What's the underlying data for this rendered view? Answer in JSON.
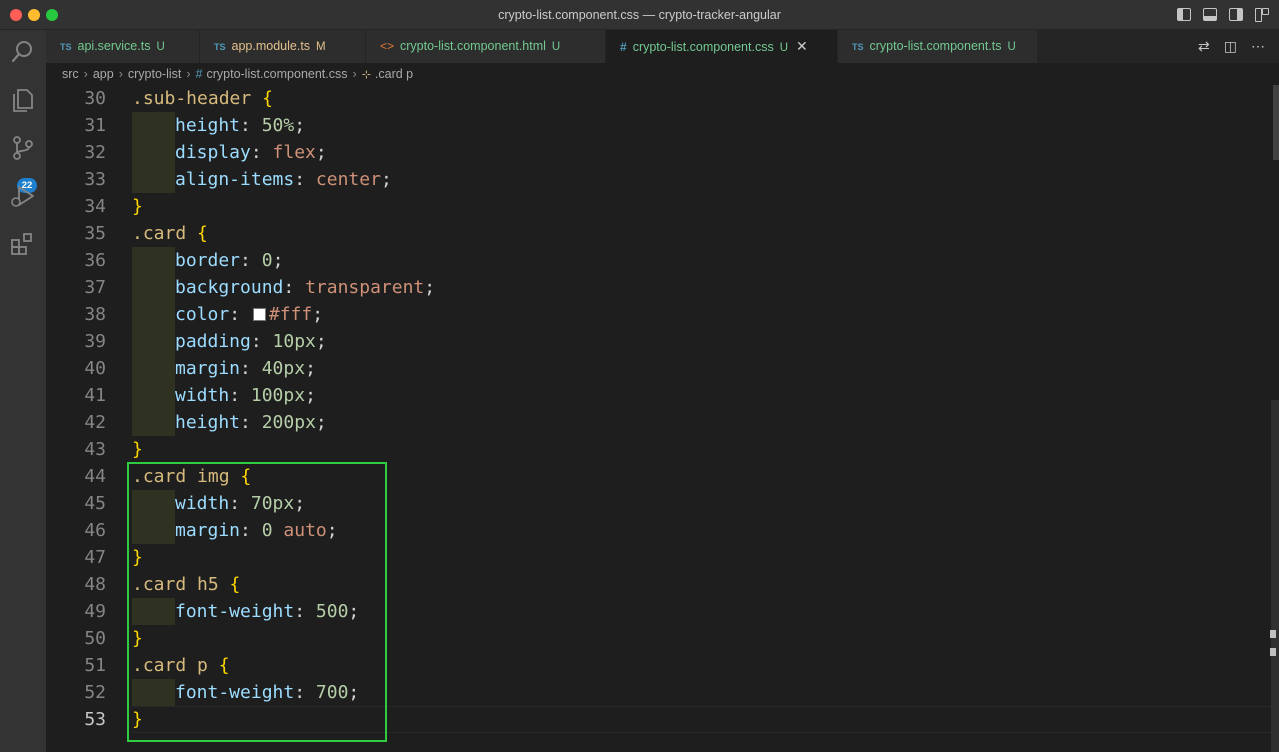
{
  "window": {
    "title": "crypto-list.component.css — crypto-tracker-angular"
  },
  "activity": {
    "scm_badge": "22"
  },
  "tabs": [
    {
      "icon": "TS",
      "label": "api.service.ts",
      "status": "U",
      "kind": "u"
    },
    {
      "icon": "TS",
      "label": "app.module.ts",
      "status": "M",
      "kind": "m"
    },
    {
      "icon": "<>",
      "label": "crypto-list.component.html",
      "status": "U",
      "kind": "u"
    },
    {
      "icon": "#",
      "label": "crypto-list.component.css",
      "status": "U",
      "kind": "u",
      "active": true
    },
    {
      "icon": "TS",
      "label": "crypto-list.component.ts",
      "status": "U",
      "kind": "u"
    }
  ],
  "breadcrumb": [
    "src",
    "app",
    "crypto-list",
    "crypto-list.component.css",
    ".card p"
  ],
  "lines": [
    {
      "n": "30",
      "sel": ".sub-header"
    },
    {
      "n": "31",
      "prop": "height",
      "num": "50%"
    },
    {
      "n": "32",
      "prop": "display",
      "val": "flex"
    },
    {
      "n": "33",
      "prop": "align-items",
      "val": "center"
    },
    {
      "n": "34",
      "close": true
    },
    {
      "n": "35",
      "sel": ".card"
    },
    {
      "n": "36",
      "prop": "border",
      "num": "0"
    },
    {
      "n": "37",
      "prop": "background",
      "val": "transparent"
    },
    {
      "n": "38",
      "prop": "color",
      "val": "#fff",
      "swatch": "#ffffff"
    },
    {
      "n": "39",
      "prop": "padding",
      "num": "10px"
    },
    {
      "n": "40",
      "prop": "margin",
      "num": "40px"
    },
    {
      "n": "41",
      "prop": "width",
      "num": "100px"
    },
    {
      "n": "42",
      "prop": "height",
      "num": "200px"
    },
    {
      "n": "43",
      "close": true
    },
    {
      "n": "44",
      "sel": ".card img"
    },
    {
      "n": "45",
      "prop": "width",
      "num": "70px"
    },
    {
      "n": "46",
      "prop": "margin",
      "num": "0",
      "val": "auto"
    },
    {
      "n": "47",
      "close": true
    },
    {
      "n": "48",
      "sel": ".card h5"
    },
    {
      "n": "49",
      "prop": "font-weight",
      "num": "500"
    },
    {
      "n": "50",
      "close": true
    },
    {
      "n": "51",
      "sel": ".card p"
    },
    {
      "n": "52",
      "prop": "font-weight",
      "num": "700"
    },
    {
      "n": "53",
      "close": true,
      "current": true
    }
  ]
}
